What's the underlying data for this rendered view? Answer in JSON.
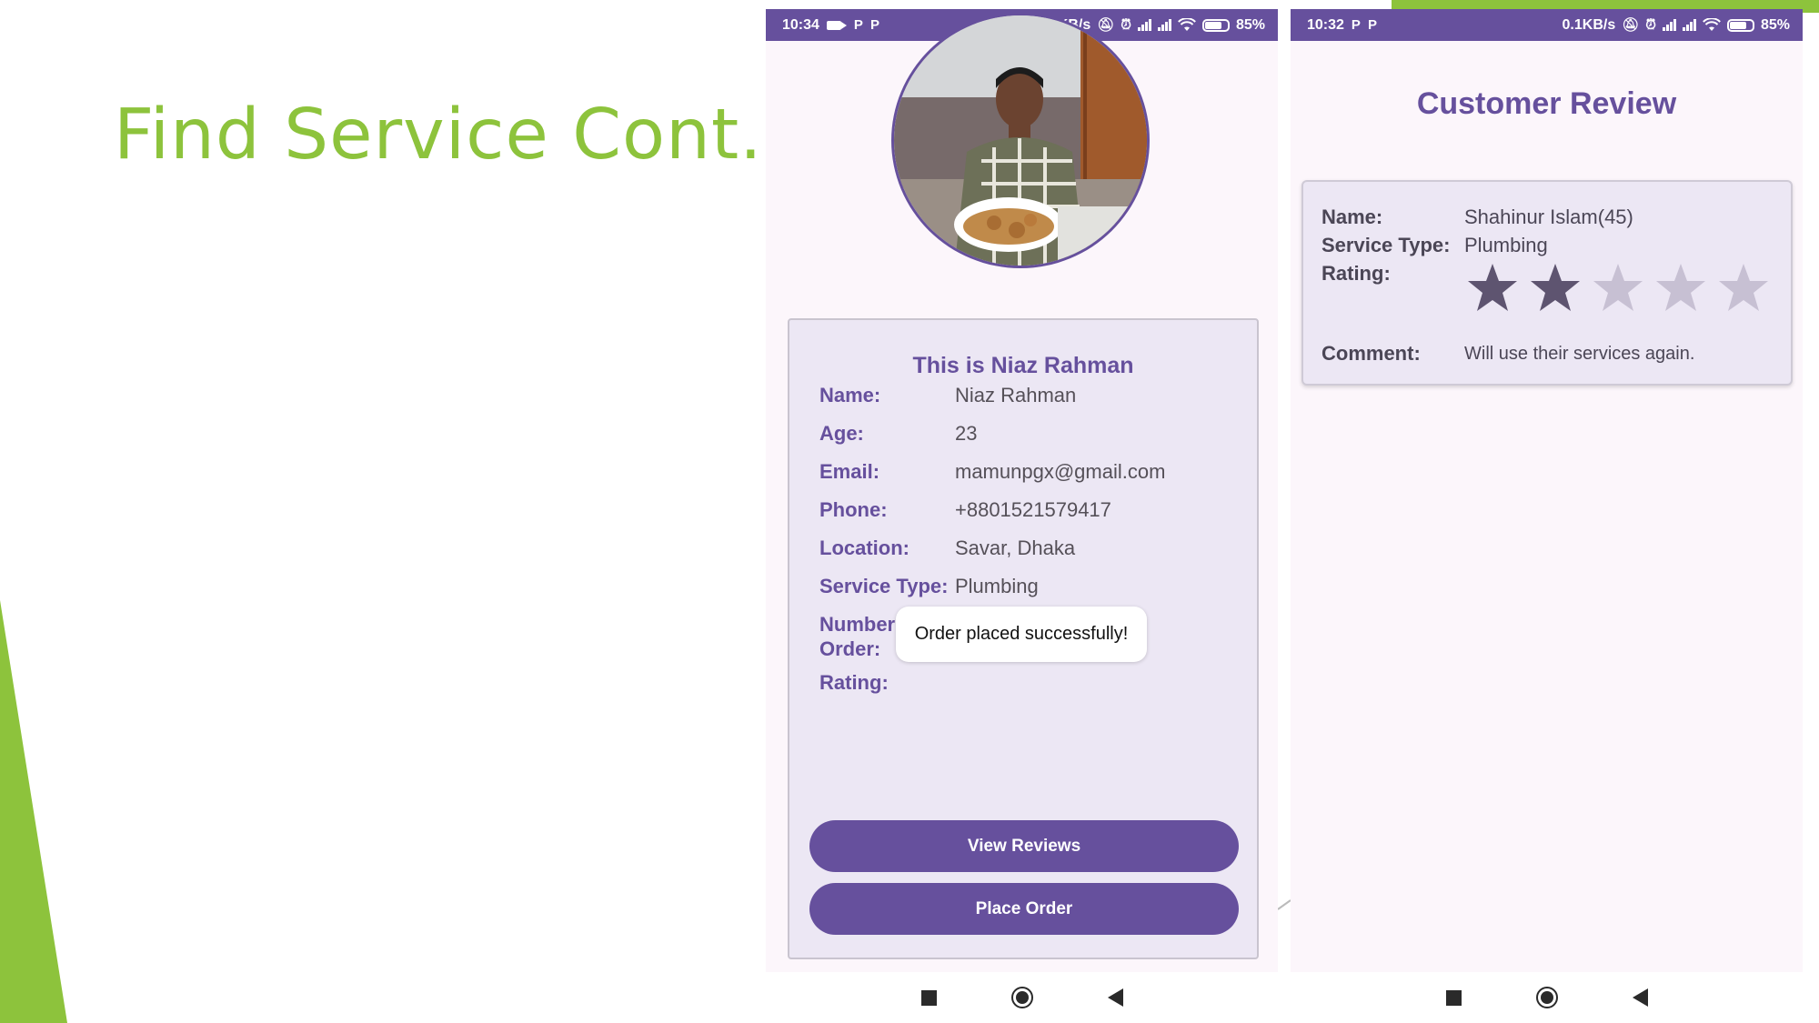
{
  "slide": {
    "title": "Find Service Cont."
  },
  "colors": {
    "accent": "#66509d",
    "title_green": "#8dc33c",
    "star_filled": "#5e5470",
    "star_empty": "#c7c0d3"
  },
  "phone1": {
    "status": {
      "time": "10:34",
      "speed": "0.1KB/s",
      "battery": "85%"
    },
    "card_title": "This is Niaz Rahman",
    "rows": [
      {
        "label": "Name:",
        "value": "Niaz Rahman"
      },
      {
        "label": "Age:",
        "value": "23"
      },
      {
        "label": "Email:",
        "value": "mamunpgx@gmail.com"
      },
      {
        "label": "Phone:",
        "value": "+8801521579417"
      },
      {
        "label": "Location:",
        "value": "Savar, Dhaka"
      },
      {
        "label": "Service Type:",
        "value": "Plumbing"
      },
      {
        "label": "Number of Order:",
        "value": "null"
      }
    ],
    "rating_label": "Rating:",
    "toast": "Order placed successfully!",
    "view_reviews": "View Reviews",
    "place_order": "Place Order"
  },
  "phone2": {
    "status": {
      "time": "10:32",
      "speed": "0.1KB/s",
      "battery": "85%"
    },
    "heading": "Customer Review",
    "review": {
      "name_label": "Name:",
      "name": "Shahinur Islam(45)",
      "service_label": "Service Type:",
      "service": "Plumbing",
      "rating_label": "Rating:",
      "rating": 2,
      "rating_max": 5,
      "comment_label": "Comment:",
      "comment": "Will use their services again."
    }
  },
  "icons": [
    "video-camera-icon",
    "parking-icon",
    "mute-icon",
    "alarm-icon",
    "signal-icon",
    "wifi-icon",
    "battery-icon",
    "recents-icon",
    "home-icon",
    "back-icon",
    "star-icon"
  ]
}
